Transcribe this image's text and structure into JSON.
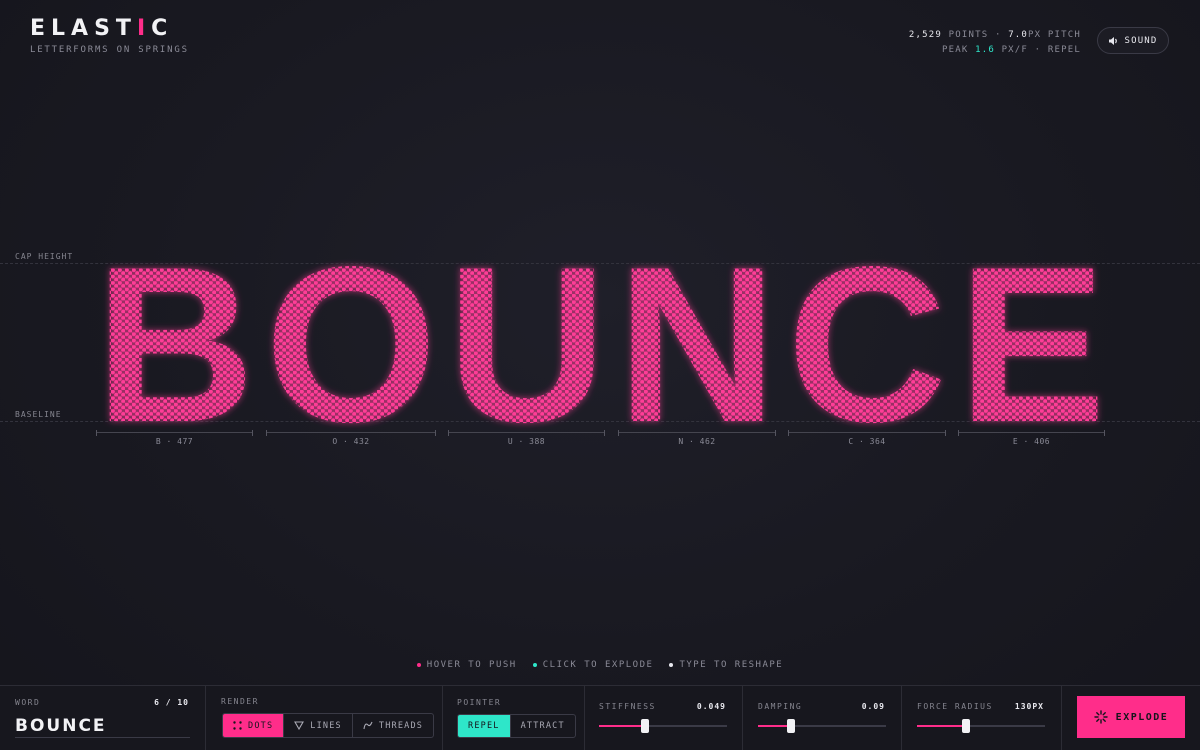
{
  "app": {
    "title_main": "ELAST",
    "title_accent": "I",
    "title_end": "C",
    "subtitle": "LETTERFORMS ON SPRINGS"
  },
  "stats": {
    "points_value": "2,529",
    "points_label": "POINTS",
    "pitch_value": "7.0",
    "pitch_label": "PX PITCH",
    "peak_label": "PEAK",
    "peak_value": "1.6",
    "peak_unit": "PX/F",
    "mode": "REPEL"
  },
  "sound": {
    "label": "SOUND",
    "icon": "speaker-icon"
  },
  "guides": {
    "cap_height": "CAP HEIGHT",
    "baseline": "BASELINE"
  },
  "word_display": "BOUNCE",
  "letters": [
    {
      "char": "B",
      "label": "B · 477"
    },
    {
      "char": "O",
      "label": "O · 432"
    },
    {
      "char": "U",
      "label": "U · 388"
    },
    {
      "char": "N",
      "label": "N · 462"
    },
    {
      "char": "C",
      "label": "C · 364"
    },
    {
      "char": "E",
      "label": "E · 406"
    }
  ],
  "hints": [
    {
      "text": "HOVER TO PUSH",
      "color": "#ff2d8a"
    },
    {
      "text": "CLICK TO EXPLODE",
      "color": "#2ee6c9"
    },
    {
      "text": "TYPE TO RESHAPE",
      "color": "#e8e8ee"
    }
  ],
  "controls": {
    "word": {
      "label": "WORD",
      "count": "6 / 10",
      "value": "BOUNCE"
    },
    "render": {
      "label": "RENDER",
      "options": [
        "DOTS",
        "LINES",
        "THREADS"
      ],
      "selected": "DOTS"
    },
    "pointer": {
      "label": "POINTER",
      "options": [
        "REPEL",
        "ATTRACT"
      ],
      "selected": "REPEL"
    },
    "stiffness": {
      "label": "STIFFNESS",
      "value": "0.049",
      "fraction": 0.36
    },
    "damping": {
      "label": "DAMPING",
      "value": "0.09",
      "fraction": 0.26
    },
    "force_radius": {
      "label": "FORCE RADIUS",
      "value": "130PX",
      "fraction": 0.38
    },
    "explode": {
      "label": "EXPLODE",
      "icon": "burst-icon"
    }
  },
  "colors": {
    "accent_pink": "#ff2d8a",
    "accent_teal": "#2ee6c9",
    "dot_color": "#ff3d97"
  }
}
